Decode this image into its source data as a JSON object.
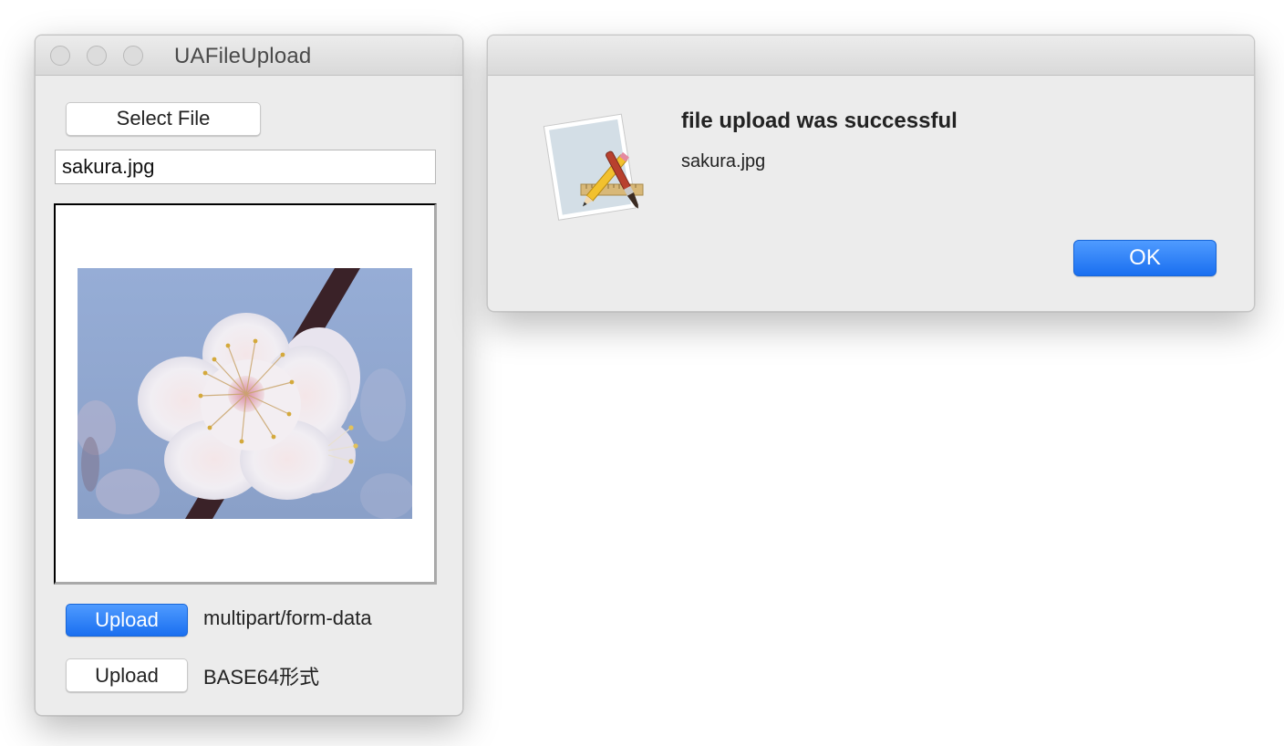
{
  "main_window": {
    "title": "UAFileUpload",
    "select_file_label": "Select File",
    "file_name": "sakura.jpg",
    "preview_image": "cherry-blossom-photo",
    "uploads": [
      {
        "button_label": "Upload",
        "description": "multipart/form-data",
        "default": true
      },
      {
        "button_label": "Upload",
        "description": "BASE64形式",
        "default": false
      }
    ]
  },
  "alert": {
    "icon": "script-editor-app-icon",
    "title": "file upload was successful",
    "message": "sakura.jpg",
    "ok_label": "OK"
  },
  "colors": {
    "accent": "#1a6ff0",
    "window_bg": "#ececec",
    "sky": "#8fa7cf"
  }
}
